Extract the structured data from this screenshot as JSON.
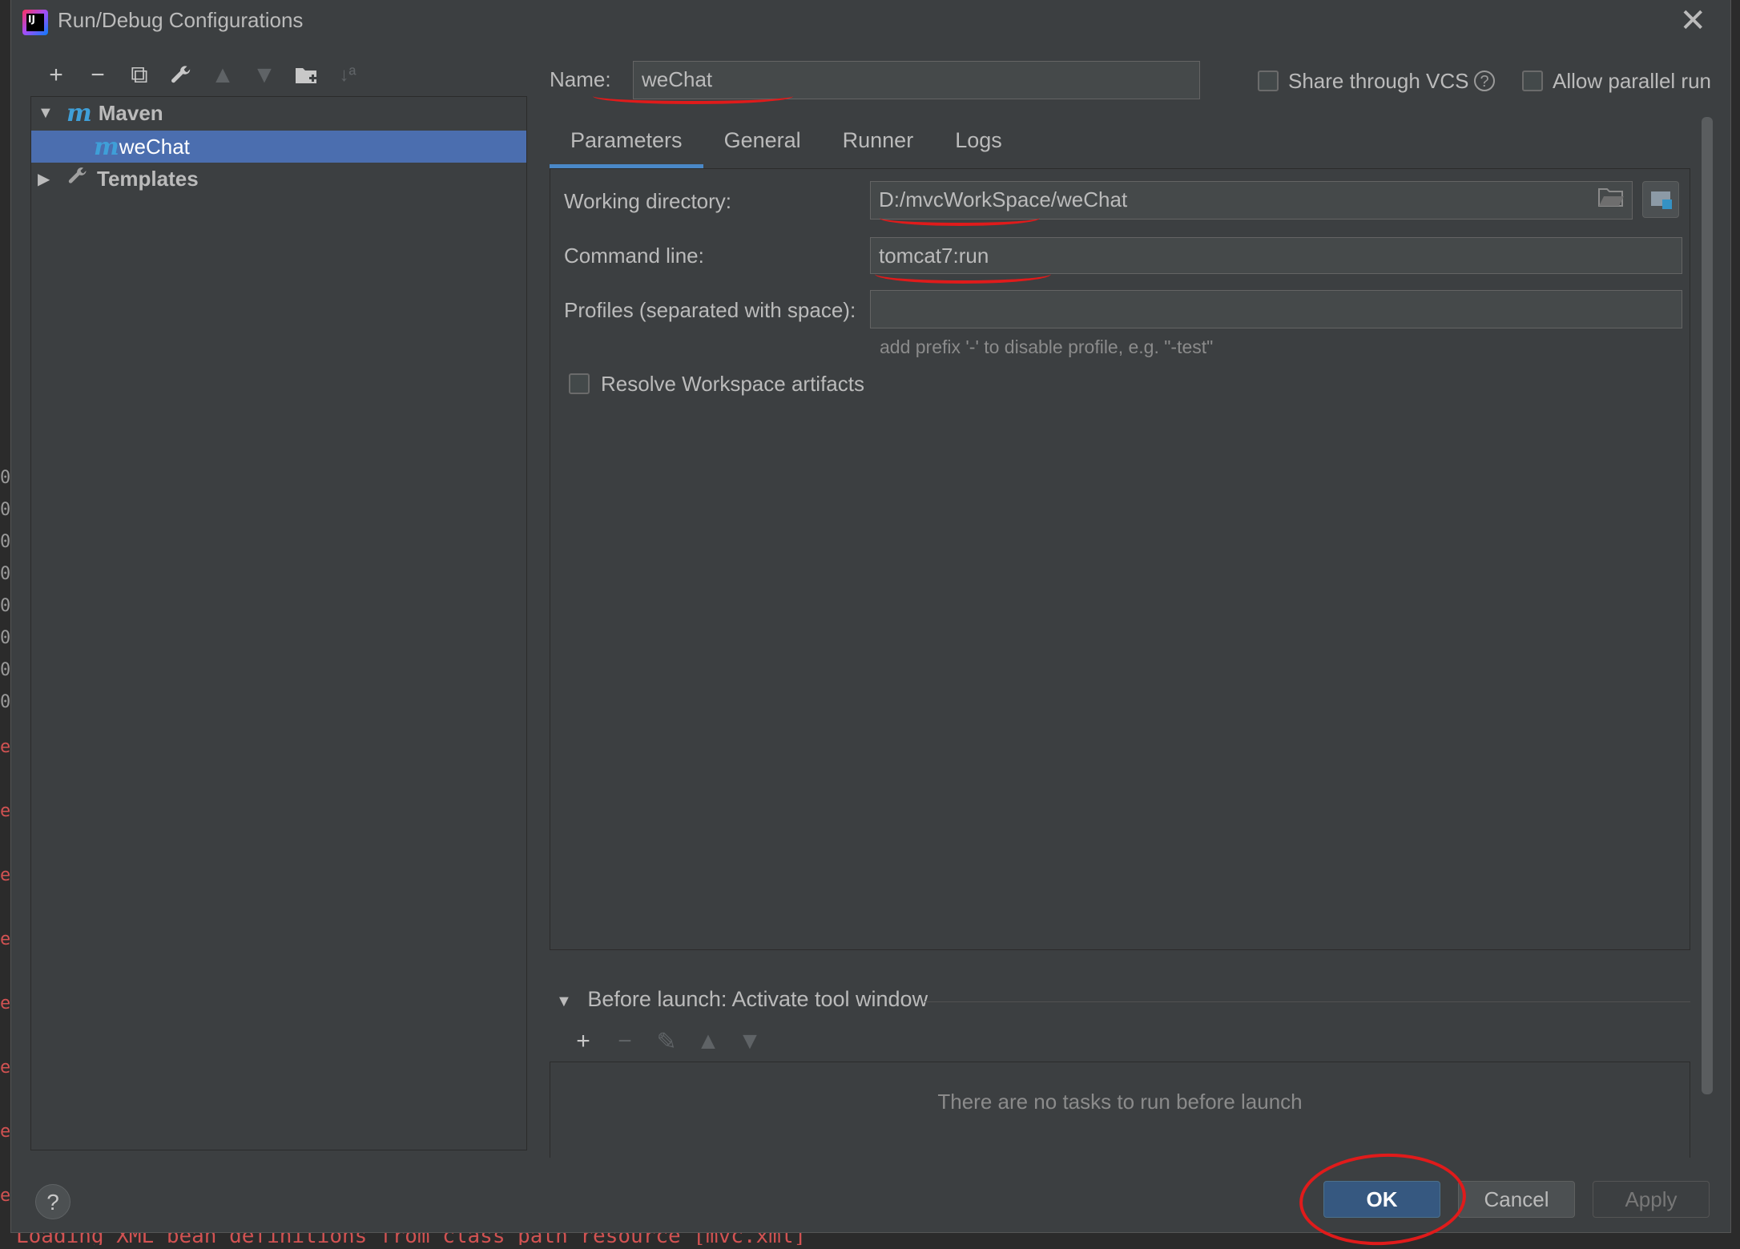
{
  "window": {
    "title": "Run/Debug Configurations"
  },
  "toolbar": {
    "add": "+",
    "remove": "−",
    "copy": "⧉",
    "edit": "🔧",
    "up": "▲",
    "down": "▼",
    "folder": "📁",
    "sort": "↓ª"
  },
  "tree": {
    "maven_label": "Maven",
    "wechat_label": "weChat",
    "templates_label": "Templates",
    "maven_icon": "m",
    "wechat_icon": "m"
  },
  "name_field": {
    "label": "Name:",
    "value": "weChat"
  },
  "share_vcs": {
    "label": "Share through VCS",
    "checked": false
  },
  "allow_parallel": {
    "label": "Allow parallel run",
    "checked": false
  },
  "tabs": [
    "Parameters",
    "General",
    "Runner",
    "Logs"
  ],
  "params": {
    "working_dir_label": "Working directory:",
    "working_dir_value": "D:/mvcWorkSpace/weChat",
    "command_line_label": "Command line:",
    "command_line_value": "tomcat7:run",
    "profiles_label": "Profiles (separated with space):",
    "profiles_value": "",
    "profiles_hint": "add prefix '-' to disable profile, e.g. \"-test\"",
    "resolve_label": "Resolve Workspace artifacts"
  },
  "before_launch": {
    "title": "Before launch: Activate tool window",
    "empty_text": "There are no tasks to run before launch"
  },
  "buttons": {
    "ok": "OK",
    "cancel": "Cancel",
    "apply": "Apply",
    "help": "?"
  },
  "background": {
    "bottom_text": "Loading XML bean definitions from class path resource [mvc.xml]"
  },
  "colors": {
    "selection": "#4b6eaf",
    "accent": "#4a88c7",
    "annotation": "#e01b1b",
    "ok_button": "#365880"
  }
}
